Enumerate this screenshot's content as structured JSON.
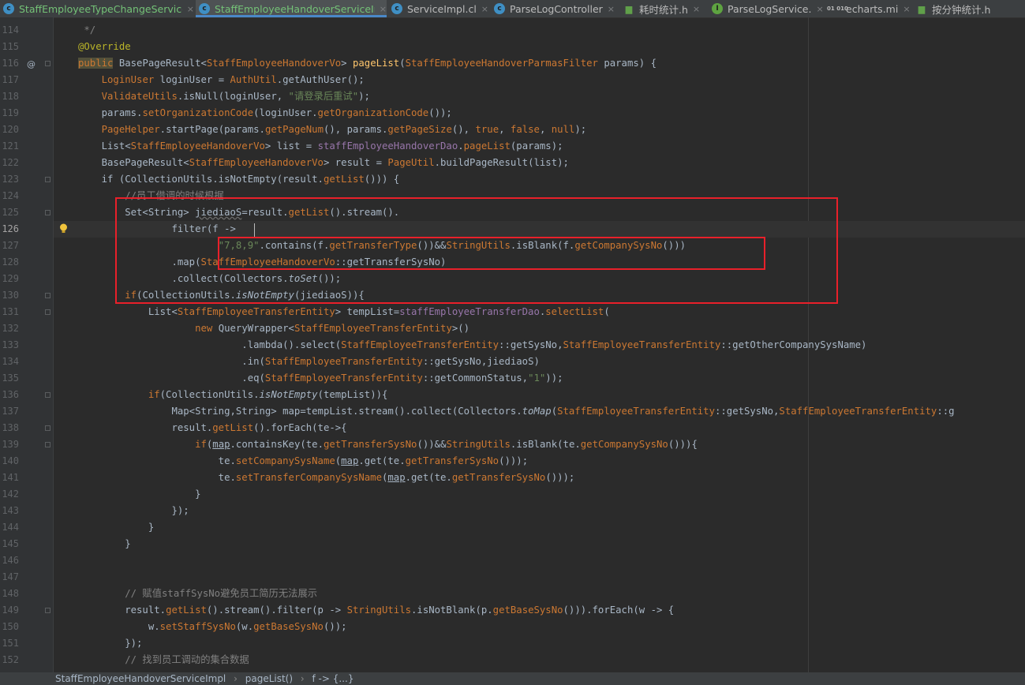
{
  "tabs": [
    {
      "label": "StaffEmployeeTypeChangeServiceIm",
      "icon": "class-icon",
      "color": "green"
    },
    {
      "label": "StaffEmployeeHandoverServiceIm",
      "icon": "class-icon",
      "color": "green",
      "active": true
    },
    {
      "label": "ServiceImpl.cl",
      "icon": "class-icon"
    },
    {
      "label": "ParseLogController",
      "icon": "class-icon"
    },
    {
      "label": "耗时统计.h",
      "icon": "html-icon"
    },
    {
      "label": "ParseLogService.",
      "icon": "interface-icon"
    },
    {
      "label": "echarts.mi",
      "icon": "binary-file-icon"
    },
    {
      "label": "按分钟统计.h",
      "icon": "html-icon"
    }
  ],
  "lines": [
    {
      "n": "114",
      "t": [
        [
          "cm",
          " */"
        ]
      ]
    },
    {
      "n": "115",
      "t": [
        [
          "an",
          "@Override"
        ]
      ]
    },
    {
      "n": "116",
      "t": [
        [
          "kw",
          "public"
        ],
        [
          "pl",
          " BasePageResult<"
        ],
        [
          "cl",
          "StaffEmployeeHandoverVo"
        ],
        [
          "pl",
          "> "
        ],
        [
          "m",
          "pageList"
        ],
        [
          "pl",
          "("
        ],
        [
          "cl",
          "StaffEmployeeHandoverParmasFilter"
        ],
        [
          "pl",
          " params) {"
        ]
      ]
    },
    {
      "n": "117",
      "t": [
        [
          "pl",
          "    "
        ],
        [
          "cl",
          "LoginUser"
        ],
        [
          "pl",
          " loginUser = "
        ],
        [
          "cl",
          "AuthUtil"
        ],
        [
          "pl",
          ".getAuthUser();"
        ]
      ]
    },
    {
      "n": "118",
      "t": [
        [
          "pl",
          "    "
        ],
        [
          "cl",
          "ValidateUtils"
        ],
        [
          "pl",
          ".isNull(loginUser, "
        ],
        [
          "st",
          "\"请登录后重试\""
        ],
        [
          "pl",
          ");"
        ]
      ]
    },
    {
      "n": "119",
      "t": [
        [
          "pl",
          "    params."
        ],
        [
          "me",
          "setOrganizationCode"
        ],
        [
          "pl",
          "(loginUser."
        ],
        [
          "me",
          "getOrganizationCode"
        ],
        [
          "pl",
          "());"
        ]
      ]
    },
    {
      "n": "120",
      "t": [
        [
          "pl",
          "    "
        ],
        [
          "cl",
          "PageHelper"
        ],
        [
          "pl",
          ".startPage(params."
        ],
        [
          "me",
          "getPageNum"
        ],
        [
          "pl",
          "(), params."
        ],
        [
          "me",
          "getPageSize"
        ],
        [
          "pl",
          "(), "
        ],
        [
          "kw",
          "true"
        ],
        [
          "pl",
          ", "
        ],
        [
          "kw",
          "false"
        ],
        [
          "pl",
          ", "
        ],
        [
          "kw",
          "null"
        ],
        [
          "pl",
          ");"
        ]
      ]
    },
    {
      "n": "121",
      "t": [
        [
          "pl",
          "    List<"
        ],
        [
          "cl",
          "StaffEmployeeHandoverVo"
        ],
        [
          "pl",
          "> list = "
        ],
        [
          "fi",
          "staffEmployeeHandoverDao"
        ],
        [
          "pl",
          "."
        ],
        [
          "me",
          "pageList"
        ],
        [
          "pl",
          "(params);"
        ]
      ]
    },
    {
      "n": "122",
      "t": [
        [
          "pl",
          "    BasePageResult<"
        ],
        [
          "cl",
          "StaffEmployeeHandoverVo"
        ],
        [
          "pl",
          "> result = "
        ],
        [
          "cl",
          "PageUtil"
        ],
        [
          "pl",
          ".buildPageResult(list);"
        ]
      ]
    },
    {
      "n": "123",
      "t": [
        [
          "pl",
          "    if (CollectionUtils.isNotEmpty(result."
        ],
        [
          "me",
          "getList"
        ],
        [
          "pl",
          "())) {"
        ]
      ]
    },
    {
      "n": "124",
      "t": [
        [
          "cm",
          "        //员工借调的时候根据"
        ]
      ]
    },
    {
      "n": "125",
      "t": [
        [
          "pl",
          "        Set<String> "
        ],
        [
          "pl",
          "jiediaoS"
        ],
        [
          "pl",
          "=result."
        ],
        [
          "me",
          "getList"
        ],
        [
          "pl",
          "().stream()."
        ]
      ]
    },
    {
      "n": "126",
      "t": [
        [
          "pl",
          "                filter(f -> "
        ]
      ]
    },
    {
      "n": "127",
      "t": [
        [
          "pl",
          "                        "
        ],
        [
          "st",
          "\"7,8,9\""
        ],
        [
          "pl",
          ".contains(f."
        ],
        [
          "me",
          "getTransferType"
        ],
        [
          "pl",
          "())&&"
        ],
        [
          "cl",
          "StringUtils"
        ],
        [
          "pl",
          ".isBlank(f."
        ],
        [
          "me",
          "getCompanySysNo"
        ],
        [
          "pl",
          "()))"
        ]
      ]
    },
    {
      "n": "128",
      "t": [
        [
          "pl",
          "                .map("
        ],
        [
          "cl",
          "StaffEmployeeHandoverVo"
        ],
        [
          "pl",
          "::getTransferSysNo)"
        ]
      ]
    },
    {
      "n": "129",
      "t": [
        [
          "pl",
          "                .collect(Collectors."
        ],
        [
          "it",
          "toSet"
        ],
        [
          "pl",
          "());"
        ]
      ]
    },
    {
      "n": "130",
      "t": [
        [
          "pl",
          "        "
        ],
        [
          "kw",
          "if"
        ],
        [
          "pl",
          "(CollectionUtils."
        ],
        [
          "it",
          "isNotEmpty"
        ],
        [
          "pl",
          "(jiediaoS)){"
        ]
      ]
    },
    {
      "n": "131",
      "t": [
        [
          "pl",
          "            List<"
        ],
        [
          "cl",
          "StaffEmployeeTransferEntity"
        ],
        [
          "pl",
          "> tempList="
        ],
        [
          "fi",
          "staffEmployeeTransferDao"
        ],
        [
          "pl",
          "."
        ],
        [
          "me",
          "selectList"
        ],
        [
          "pl",
          "("
        ]
      ]
    },
    {
      "n": "132",
      "t": [
        [
          "pl",
          "                    "
        ],
        [
          "kw",
          "new"
        ],
        [
          "pl",
          " QueryWrapper<"
        ],
        [
          "cl",
          "StaffEmployeeTransferEntity"
        ],
        [
          "pl",
          ">()"
        ]
      ]
    },
    {
      "n": "133",
      "t": [
        [
          "pl",
          "                            .lambda().select("
        ],
        [
          "cl",
          "StaffEmployeeTransferEntity"
        ],
        [
          "pl",
          "::getSysNo,"
        ],
        [
          "cl",
          "StaffEmployeeTransferEntity"
        ],
        [
          "pl",
          "::getOtherCompanySysName)"
        ]
      ]
    },
    {
      "n": "134",
      "t": [
        [
          "pl",
          "                            .in("
        ],
        [
          "cl",
          "StaffEmployeeTransferEntity"
        ],
        [
          "pl",
          "::getSysNo,jiediaoS)"
        ]
      ]
    },
    {
      "n": "135",
      "t": [
        [
          "pl",
          "                            .eq("
        ],
        [
          "cl",
          "StaffEmployeeTransferEntity"
        ],
        [
          "pl",
          "::getCommonStatus,"
        ],
        [
          "st",
          "\"1\""
        ],
        [
          "pl",
          "));"
        ]
      ]
    },
    {
      "n": "136",
      "t": [
        [
          "pl",
          "            "
        ],
        [
          "kw",
          "if"
        ],
        [
          "pl",
          "(CollectionUtils."
        ],
        [
          "it",
          "isNotEmpty"
        ],
        [
          "pl",
          "(tempList)){"
        ]
      ]
    },
    {
      "n": "137",
      "t": [
        [
          "pl",
          "                Map<String,String> map=tempList.stream().collect(Collectors."
        ],
        [
          "it",
          "toMap"
        ],
        [
          "pl",
          "("
        ],
        [
          "cl",
          "StaffEmployeeTransferEntity"
        ],
        [
          "pl",
          "::getSysNo,"
        ],
        [
          "cl",
          "StaffEmployeeTransferEntity"
        ],
        [
          "pl",
          "::g"
        ]
      ]
    },
    {
      "n": "138",
      "t": [
        [
          "pl",
          "                result."
        ],
        [
          "me",
          "getList"
        ],
        [
          "pl",
          "().forEach(te->{"
        ]
      ]
    },
    {
      "n": "139",
      "t": [
        [
          "pl",
          "                    "
        ],
        [
          "kw",
          "if"
        ],
        [
          "pl",
          "("
        ],
        [
          "ul",
          "map"
        ],
        [
          "pl",
          ".containsKey(te."
        ],
        [
          "me",
          "getTransferSysNo"
        ],
        [
          "pl",
          "())&&"
        ],
        [
          "cl",
          "StringUtils"
        ],
        [
          "pl",
          ".isBlank(te."
        ],
        [
          "me",
          "getCompanySysNo"
        ],
        [
          "pl",
          "())){"
        ]
      ]
    },
    {
      "n": "140",
      "t": [
        [
          "pl",
          "                        te."
        ],
        [
          "me",
          "setCompanySysName"
        ],
        [
          "pl",
          "("
        ],
        [
          "ul",
          "map"
        ],
        [
          "pl",
          ".get(te."
        ],
        [
          "me",
          "getTransferSysNo"
        ],
        [
          "pl",
          "()));"
        ]
      ]
    },
    {
      "n": "141",
      "t": [
        [
          "pl",
          "                        te."
        ],
        [
          "me",
          "setTransferCompanySysName"
        ],
        [
          "pl",
          "("
        ],
        [
          "ul",
          "map"
        ],
        [
          "pl",
          ".get(te."
        ],
        [
          "me",
          "getTransferSysNo"
        ],
        [
          "pl",
          "()));"
        ]
      ]
    },
    {
      "n": "142",
      "t": [
        [
          "pl",
          "                    }"
        ]
      ]
    },
    {
      "n": "143",
      "t": [
        [
          "pl",
          "                });"
        ]
      ]
    },
    {
      "n": "144",
      "t": [
        [
          "pl",
          "            }"
        ]
      ]
    },
    {
      "n": "145",
      "t": [
        [
          "pl",
          "        }"
        ]
      ]
    },
    {
      "n": "146",
      "t": []
    },
    {
      "n": "147",
      "t": []
    },
    {
      "n": "148",
      "t": [
        [
          "cm",
          "        // 赋值staffSysNo避免员工简历无法展示"
        ]
      ]
    },
    {
      "n": "149",
      "t": [
        [
          "pl",
          "        result."
        ],
        [
          "me",
          "getList"
        ],
        [
          "pl",
          "().stream().filter(p -> "
        ],
        [
          "cl",
          "StringUtils"
        ],
        [
          "pl",
          ".isNotBlank(p."
        ],
        [
          "me",
          "getBaseSysNo"
        ],
        [
          "pl",
          "())).forEach(w -> {"
        ]
      ]
    },
    {
      "n": "150",
      "t": [
        [
          "pl",
          "            w."
        ],
        [
          "me",
          "setStaffSysNo"
        ],
        [
          "pl",
          "(w."
        ],
        [
          "me",
          "getBaseSysNo"
        ],
        [
          "pl",
          "());"
        ]
      ]
    },
    {
      "n": "151",
      "t": [
        [
          "pl",
          "        });"
        ]
      ]
    },
    {
      "n": "152",
      "t": [
        [
          "cm",
          "        // 找到员工调动的集合数据"
        ]
      ]
    },
    {
      "n": "153",
      "t": [
        [
          "pl",
          "        "
        ]
      ]
    }
  ],
  "current_line": "126",
  "breadcrumb": [
    "StaffEmployeeHandoverServiceImpl",
    "pageList()",
    "f -> {...}"
  ],
  "colors": {
    "highlight_box": "#e8202a",
    "active_tab_underline": "#4a88c7"
  }
}
